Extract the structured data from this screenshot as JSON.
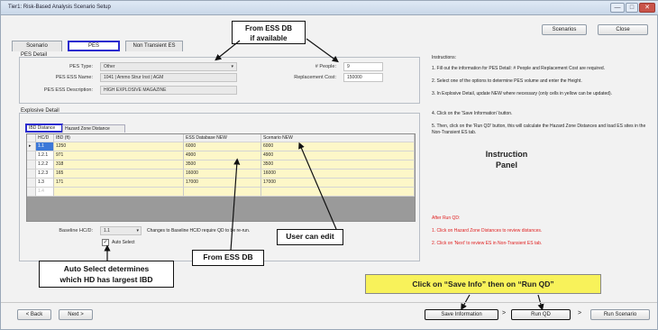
{
  "window": {
    "title": "Tier1: Risk-Based Analysis Scenario Setup",
    "minimize_glyph": "—",
    "maximize_glyph": "□",
    "close_glyph": "✕"
  },
  "toolbar": {
    "scenarios_label": "Scenarios",
    "close_label": "Close"
  },
  "tabs": [
    {
      "label": "Scenario",
      "active": false
    },
    {
      "label": "PES",
      "active": true
    },
    {
      "label": "Non Transient ES",
      "active": false
    }
  ],
  "pes_detail": {
    "title": "PES Detail",
    "type_label": "PES Type:",
    "type_value": "Other",
    "ess_name_label": "PES ESS Name:",
    "ess_name_value": "1041 | Ammo Strur Inst | AGM",
    "description_label": "PES ESS Description:",
    "description_value": "HIGH EXPLOSIVE MAGAZINE",
    "people_label": "# People:",
    "people_value": "9",
    "cost_label": "Replacement Cost:",
    "cost_value": "150000"
  },
  "explosive_detail": {
    "title": "Explosive Detail",
    "subtab_ibd": "IBD Distance",
    "subtab_hazard": "Hazard Zone Distance",
    "columns": [
      "HC/D",
      "IBD (ft)",
      "ESS Database NEW",
      "Scenario NEW"
    ],
    "rows": [
      {
        "marker": "▸",
        "hcd": "1.1",
        "ibd": "1250",
        "ess": "6000",
        "scenario": "6000"
      },
      {
        "marker": "",
        "hcd": "1.2.1",
        "ibd": "971",
        "ess": "4900",
        "scenario": "4900"
      },
      {
        "marker": "",
        "hcd": "1.2.2",
        "ibd": "318",
        "ess": "3500",
        "scenario": "3500"
      },
      {
        "marker": "",
        "hcd": "1.2.3",
        "ibd": "165",
        "ess": "16000",
        "scenario": "16000"
      },
      {
        "marker": "",
        "hcd": "1.3",
        "ibd": "171",
        "ess": "17000",
        "scenario": "17000"
      },
      {
        "marker": "",
        "hcd": "1.4",
        "ibd": "",
        "ess": "",
        "scenario": ""
      }
    ],
    "baseline_label": "Baseline HC/D:",
    "baseline_value": "1.1",
    "baseline_note": "Changes to Baseline HC/D require QD to be re-run.",
    "auto_select_label": "Auto Select"
  },
  "instructions": {
    "title": "Instructions:",
    "items": [
      "1. Fill out the information for PES Detail: # People and Replacement Cost are required.",
      "2. Select one of the options to determine PES volume and enter the Height.",
      "3. In Explosive Detail, update NEW where necessary (only cells in yellow can be updated).",
      "4. Click on the 'Save Information' button.",
      "5. Then, click on the 'Run QD' button, this will calculate the Hazard Zone Distances and load ES sites in the Non-Transient ES tab."
    ],
    "after_title": "After Run QD:",
    "after_items": [
      "1. Click on Hazard Zone Distances to review distances.",
      "2. Click on 'Next' to review ES in Non-Transient ES tab."
    ]
  },
  "callouts": {
    "ess_db_line1": "From ESS DB",
    "ess_db_line2": "if available",
    "instruction_line1": "Instruction",
    "instruction_line2": "Panel",
    "user_can_edit": "User can edit",
    "from_ess_db": "From ESS DB",
    "auto_select_line1": "Auto Select determines",
    "auto_select_line2": "which HD has largest IBD",
    "save_run": "Click on “Save Info” then on “Run QD”"
  },
  "footer": {
    "back_label": "< Back",
    "next_label": "Next >",
    "save_label": "Save Information",
    "run_qd_label": "Run QD",
    "run_scenario_label": "Run Scenario",
    "sep1": ">",
    "sep2": ">"
  },
  "colors": {
    "editable_cell": "#fdf7c8",
    "highlight_blue": "#2b2bcf",
    "callout_yellow": "#f8f25a",
    "red_text": "#e02020"
  }
}
